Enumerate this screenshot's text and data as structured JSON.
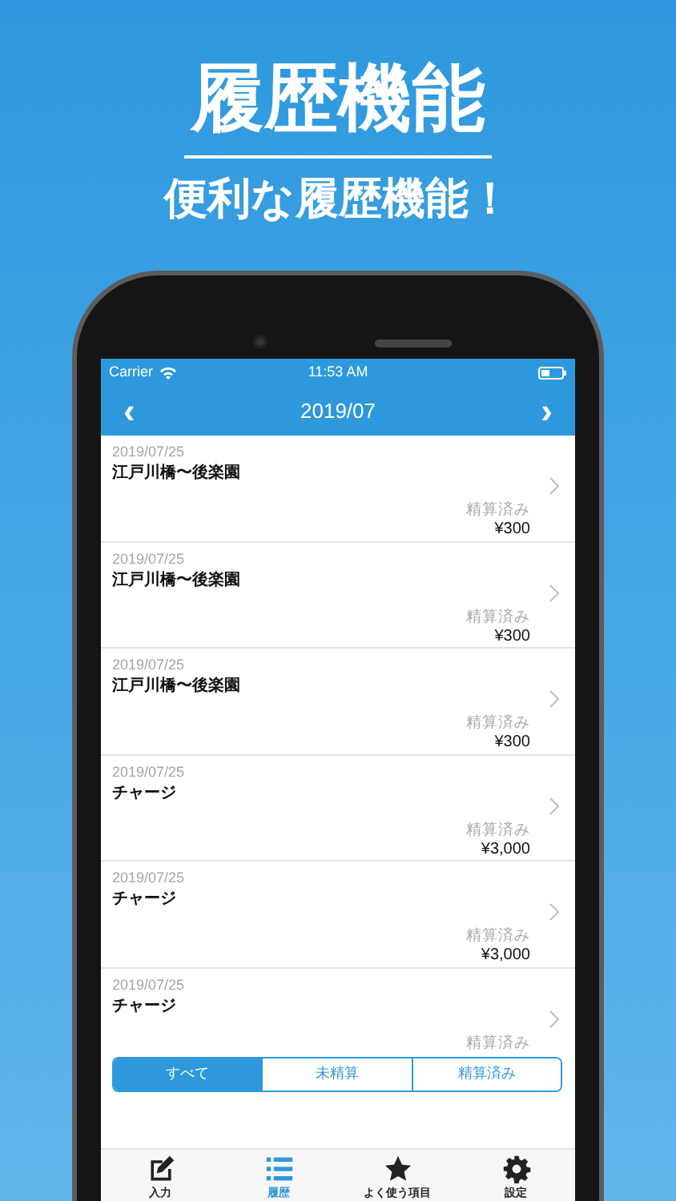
{
  "headline": "履歴機能",
  "subtitle": "便利な履歴機能！",
  "status_bar": {
    "carrier": "Carrier",
    "time": "11:53 AM"
  },
  "nav_bar": {
    "prev": "‹",
    "title": "2019/07",
    "next": "›"
  },
  "history": [
    {
      "date": "2019/07/25",
      "title": "江戸川橋〜後楽園",
      "status": "精算済み",
      "amount": "¥300"
    },
    {
      "date": "2019/07/25",
      "title": "江戸川橋〜後楽園",
      "status": "精算済み",
      "amount": "¥300"
    },
    {
      "date": "2019/07/25",
      "title": "江戸川橋〜後楽園",
      "status": "精算済み",
      "amount": "¥300"
    },
    {
      "date": "2019/07/25",
      "title": "チャージ",
      "status": "精算済み",
      "amount": "¥3,000"
    },
    {
      "date": "2019/07/25",
      "title": "チャージ",
      "status": "精算済み",
      "amount": "¥3,000"
    },
    {
      "date": "2019/07/25",
      "title": "チャージ",
      "status": "精算済み"
    }
  ],
  "filter_segments": [
    {
      "label": "すべて",
      "selected": true
    },
    {
      "label": "未精算",
      "selected": false
    },
    {
      "label": "精算済み",
      "selected": false
    }
  ],
  "tab_bar": [
    {
      "kind": "edit",
      "label": "入力",
      "selected": false
    },
    {
      "kind": "list",
      "label": "履歴",
      "selected": true
    },
    {
      "kind": "star",
      "label": "よく使う項目",
      "selected": false
    },
    {
      "kind": "gear",
      "label": "設定",
      "selected": false
    }
  ]
}
